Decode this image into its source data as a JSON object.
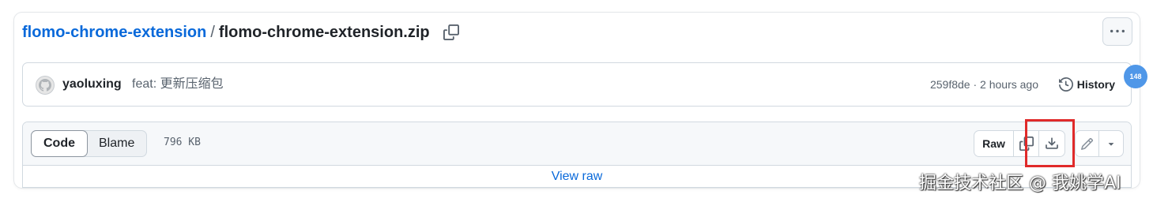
{
  "breadcrumb": {
    "repo": "flomo-chrome-extension",
    "separator": "/",
    "file": "flomo-chrome-extension.zip"
  },
  "header": {
    "more_icon": "kebab-horizontal-icon",
    "copy_icon": "copy-icon"
  },
  "commit": {
    "author": "yaoluxing",
    "message": "feat: 更新压缩包",
    "sha": "259f8de",
    "dot": "·",
    "time": "2 hours ago",
    "history_label": "History"
  },
  "badge": {
    "count": "148",
    "color": "#4f97e8"
  },
  "file_toolbar": {
    "tabs": [
      {
        "label": "Code",
        "active": true
      },
      {
        "label": "Blame",
        "active": false
      }
    ],
    "size": "796 KB",
    "raw_label": "Raw",
    "view_raw_label": "View raw"
  },
  "colors": {
    "link": "#0969da",
    "highlight": "#e02a2a"
  },
  "watermark": "掘金技术社区 @ 我姚学AI"
}
